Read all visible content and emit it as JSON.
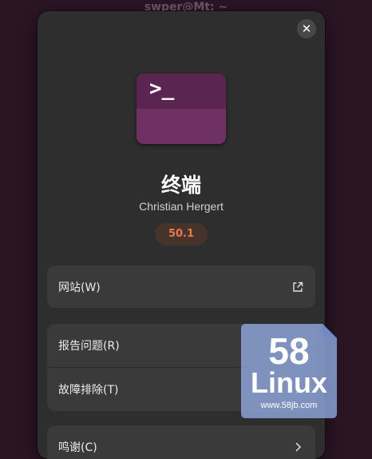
{
  "background": {
    "title": "swper@Mt: ~"
  },
  "dialog": {
    "close_label": "✕",
    "app_icon_text": ">_",
    "app_name": "终端",
    "developer": "Christian Hergert",
    "version": "50.1",
    "groups": [
      {
        "rows": [
          {
            "label": "网站(W)",
            "icon": "external-link-icon"
          }
        ]
      },
      {
        "rows": [
          {
            "label": "报告问题(R)",
            "icon": "external-link-icon"
          },
          {
            "label": "故障排除(T)",
            "icon": "chevron-right-icon"
          }
        ]
      },
      {
        "rows": [
          {
            "label": "鸣谢(C)",
            "icon": "chevron-right-icon"
          }
        ]
      }
    ]
  },
  "watermark": {
    "number": "58",
    "brand": "Linux",
    "url": "www.58jb.com"
  },
  "colors": {
    "accent": "#e87a4c",
    "dialog_bg": "#2e2e2e",
    "row_bg": "#3a3a3a",
    "icon_bg": "#6a2e5e"
  }
}
